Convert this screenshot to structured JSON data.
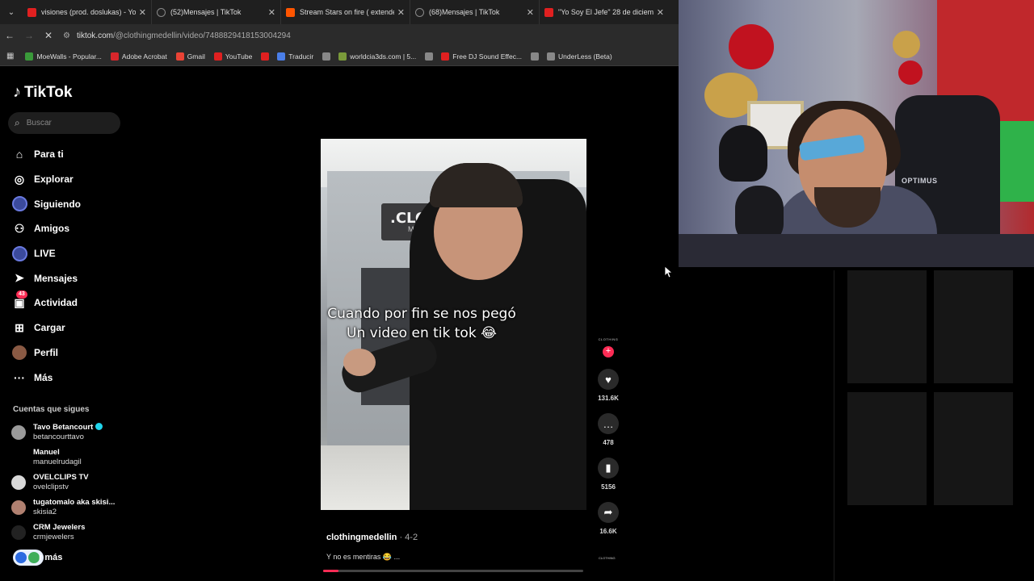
{
  "browser": {
    "tabs": [
      {
        "title": "visiones (prod. doslukas) - YouT",
        "icon": "youtube"
      },
      {
        "title": "(52)Mensajes | TikTok",
        "icon": "tiktok"
      },
      {
        "title": "Stream Stars on fire ( extended",
        "icon": "soundcloud"
      },
      {
        "title": "(68)Mensajes | TikTok",
        "icon": "tiktok"
      },
      {
        "title": "\"Yo Soy El Jefe\" 28 de diciembr",
        "icon": "youtube"
      }
    ],
    "url_host": "tiktok.com",
    "url_path": "/@clothingmedellin/video/7488829418153004294",
    "bookmarks": [
      {
        "label": "MoeWalls - Popular...",
        "color": "#3a9a3a"
      },
      {
        "label": "Adobe Acrobat",
        "color": "#d7262b"
      },
      {
        "label": "Gmail",
        "color": "#ea4335"
      },
      {
        "label": "YouTube",
        "color": "#e02020"
      },
      {
        "label": "",
        "color": "#e02020"
      },
      {
        "label": "Traducir",
        "color": "#4a7ee8"
      },
      {
        "label": "",
        "color": "#888888"
      },
      {
        "label": "worldcia3ds.com | 5...",
        "color": "#7a9a3a"
      },
      {
        "label": "",
        "color": "#888888"
      },
      {
        "label": "Free DJ Sound Effec...",
        "color": "#e02020"
      },
      {
        "label": "",
        "color": "#888888"
      },
      {
        "label": "UnderLess (Beta)",
        "color": "#888888"
      }
    ]
  },
  "tiktok": {
    "logo_text": "TikTok",
    "search_placeholder": "Buscar",
    "nav": [
      {
        "label": "Para ti",
        "icon": "home-icon"
      },
      {
        "label": "Explorar",
        "icon": "compass-icon"
      },
      {
        "label": "Siguiendo",
        "icon": "following-avatar-icon"
      },
      {
        "label": "Amigos",
        "icon": "friends-icon"
      },
      {
        "label": "LIVE",
        "icon": "live-icon"
      },
      {
        "label": "Mensajes",
        "icon": "send-icon"
      },
      {
        "label": "Actividad",
        "icon": "inbox-icon",
        "badge": "43"
      },
      {
        "label": "Cargar",
        "icon": "upload-icon"
      },
      {
        "label": "Perfil",
        "icon": "profile-avatar-icon"
      },
      {
        "label": "Más",
        "icon": "more-icon"
      }
    ],
    "following_heading": "Cuentas que sigues",
    "followed_accounts": [
      {
        "name": "Tavo Betancourt",
        "user": "betancourttavo",
        "verified": true,
        "avatar_color": "#9a9a9a"
      },
      {
        "name": "Manuel",
        "user": "manuelrudagil",
        "verified": false,
        "avatar_color": "#000000"
      },
      {
        "name": "OVELCLIPS TV",
        "user": "ovelclipstv",
        "verified": false,
        "avatar_color": "#d8d8d8"
      },
      {
        "name": "tugatomalo aka skisi...",
        "user": "skisia2",
        "verified": false,
        "avatar_color": "#b08070"
      },
      {
        "name": "CRM Jewelers",
        "user": "crmjewelers",
        "verified": false,
        "avatar_color": "#222222"
      }
    ],
    "see_more": "r más",
    "video": {
      "caption_line1": "Cuando por fin se nos pegó",
      "caption_line2": "Un video en tik tok 😂",
      "sign_text": ".CLO",
      "sign_sub": "MED",
      "author": "clothingmedellin",
      "date": " · 4-2",
      "description": "Y no es mentiras 😂 ...",
      "progress": 0.06
    },
    "actions": {
      "brand": "CLOTHING",
      "likes": "131.6K",
      "comments": "478",
      "saves": "5156",
      "shares": "16.6K"
    }
  },
  "webcam": {
    "chair_brand": "OPTIMUS"
  }
}
